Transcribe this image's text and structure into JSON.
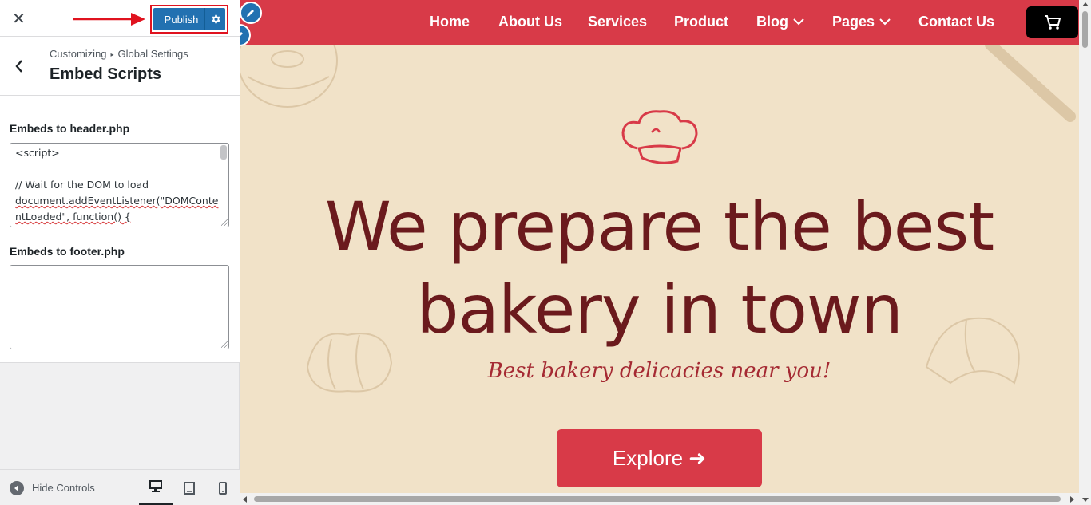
{
  "customizer": {
    "close_label": "✕",
    "publish_label": "Publish",
    "breadcrumb": {
      "root": "Customizing",
      "separator": "▸",
      "parent": "Global Settings"
    },
    "section_title": "Embed Scripts",
    "header_embed": {
      "label": "Embeds to header.php",
      "value_lines": [
        "<script>",
        "",
        "// Wait for the DOM to load",
        "document.addEventListener(\"DOMConte",
        "ntLoaded\", function() {"
      ]
    },
    "footer_embed": {
      "label": "Embeds to footer.php",
      "value": ""
    },
    "hide_controls_label": "Hide Controls",
    "devices": [
      "desktop-icon",
      "tablet-icon",
      "mobile-icon"
    ]
  },
  "site": {
    "nav": [
      {
        "label": "Home",
        "dropdown": false
      },
      {
        "label": "About Us",
        "dropdown": false
      },
      {
        "label": "Services",
        "dropdown": false
      },
      {
        "label": "Product",
        "dropdown": false
      },
      {
        "label": "Blog",
        "dropdown": true
      },
      {
        "label": "Pages",
        "dropdown": true
      },
      {
        "label": "Contact Us",
        "dropdown": false
      }
    ],
    "hero": {
      "title_line1": "We prepare the best",
      "title_line2": "bakery in town",
      "subtitle": "Best bakery delicacies near you!",
      "button_label": "Explore ➜"
    }
  },
  "colors": {
    "publish_blue": "#2271b1",
    "brand_red": "#d83a48",
    "hero_bg": "#f1e2c8",
    "title_maroon": "#6b1a1d",
    "annotation_red": "#e0131f"
  }
}
